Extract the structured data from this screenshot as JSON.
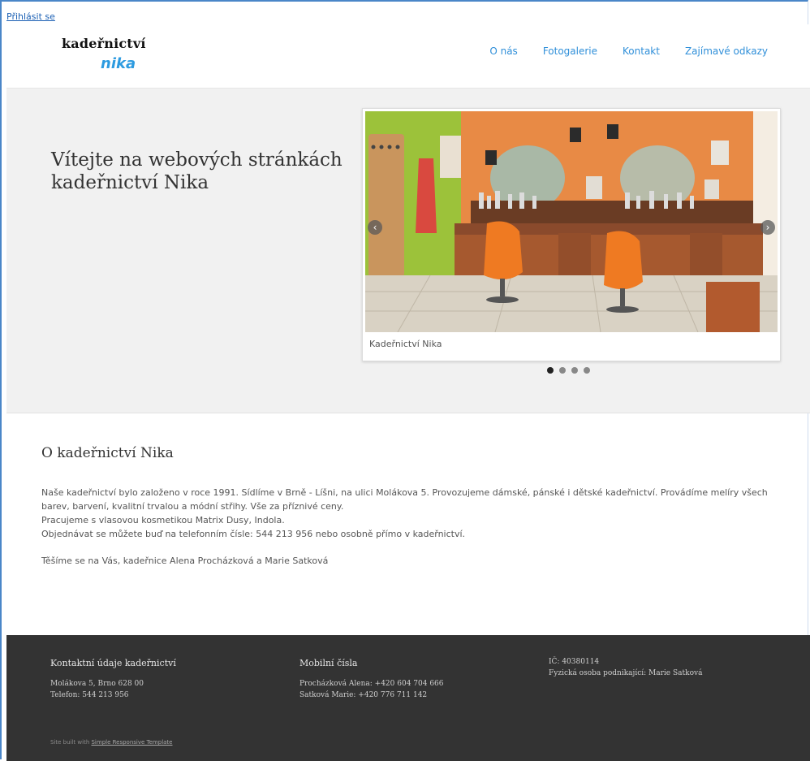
{
  "login_link": "Přihlásit se",
  "logo": {
    "line1": "kadeřnictví",
    "line2": "nika"
  },
  "nav": [
    "O nás",
    "Fotogalerie",
    "Kontakt",
    "Zajímavé odkazy"
  ],
  "hero": {
    "title": "Vítejte na webových stránkách kadeřnictví Nika",
    "slider": {
      "caption": "Kadeřnictví Nika",
      "prev_icon": "chevron-left-icon",
      "next_icon": "chevron-right-icon",
      "slide_count": 4,
      "active_slide": 1
    }
  },
  "about": {
    "heading": "O kadeřnictví Nika",
    "lines": [
      "Naše kadeřnictví bylo založeno v roce 1991. Sídlíme v Brně - Líšni, na ulici Molákova 5. Provozujeme dámské, pánské i dětské kadeřnictví. Provádíme melíry všech barev, barvení, kvalitní trvalou a módní střihy. Vše za příznivé ceny.",
      "Pracujeme s vlasovou kosmetikou Matrix Dusy, Indola.",
      "Objednávat se můžete buď na telefonním čísle: 544 213 956 nebo osobně přímo v kadeřnictví."
    ],
    "thanks": "Těšíme se na Vás, kadeřnice Alena Procházková a Marie Satková"
  },
  "footer": {
    "col1": {
      "title": "Kontaktní údaje kadeřnictví",
      "lines": [
        "Molákova 5, Brno 628 00",
        "Telefon: 544 213 956"
      ]
    },
    "col2": {
      "title": "Mobilní čísla",
      "lines": [
        "Procházková Alena: +420 604 704 666",
        "Satková Marie: +420 776 711 142"
      ]
    },
    "col3": {
      "lines": [
        "IČ: 40380114",
        "Fyzická osoba podnikající: Marie Satková"
      ]
    },
    "credit_prefix": "Site built with ",
    "credit_link": "Simple Responsive Template"
  },
  "colors": {
    "accent": "#2f8fd9",
    "footer_bg": "#333333",
    "hero_bg": "#f1f1f1"
  }
}
